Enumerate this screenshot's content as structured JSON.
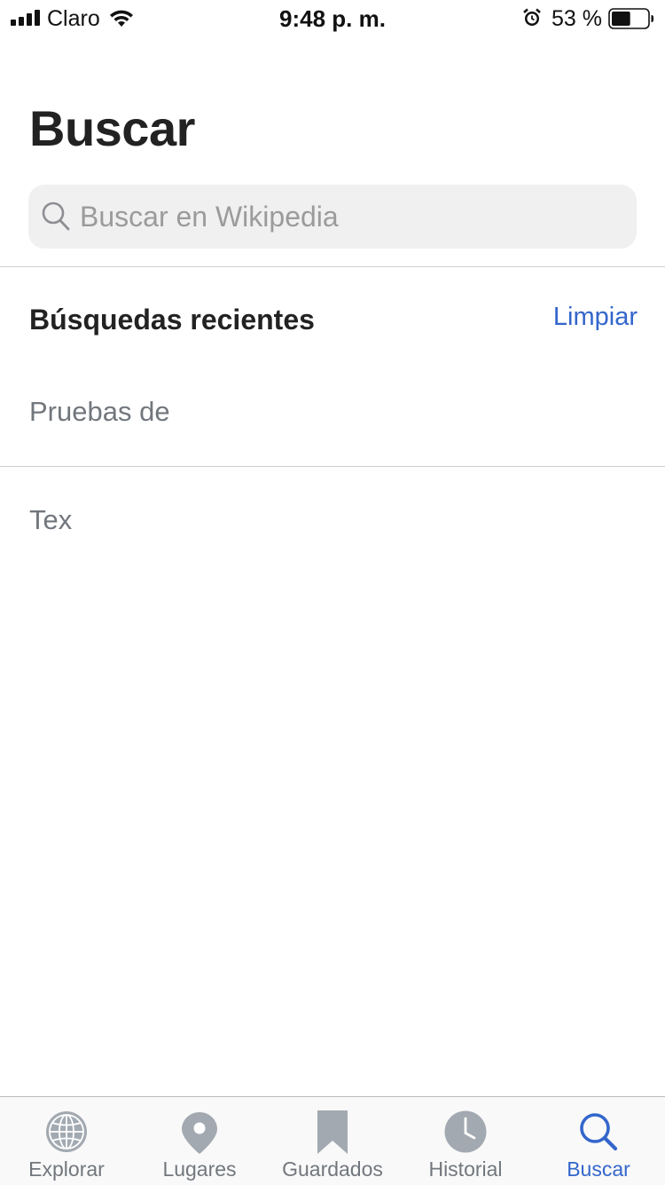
{
  "status_bar": {
    "carrier": "Claro",
    "time": "9:48 p. m.",
    "battery_percent": "53 %",
    "battery_level": 0.53
  },
  "page": {
    "title": "Buscar"
  },
  "search": {
    "placeholder": "Buscar en Wikipedia",
    "value": ""
  },
  "recent": {
    "title": "Búsquedas recientes",
    "clear_label": "Limpiar",
    "items": [
      {
        "label": "Pruebas de"
      },
      {
        "label": "Tex"
      }
    ]
  },
  "tab_bar": {
    "tabs": [
      {
        "label": "Explorar",
        "icon": "globe-icon"
      },
      {
        "label": "Lugares",
        "icon": "map-pin-icon"
      },
      {
        "label": "Guardados",
        "icon": "bookmark-icon"
      },
      {
        "label": "Historial",
        "icon": "clock-icon"
      },
      {
        "label": "Buscar",
        "icon": "search-icon",
        "active": true
      }
    ]
  },
  "colors": {
    "accent": "#3366cc",
    "inactive": "#72777d",
    "icon_gray": "#a2a9b1",
    "search_bg": "#f0f0f0",
    "title_text": "#222222"
  }
}
